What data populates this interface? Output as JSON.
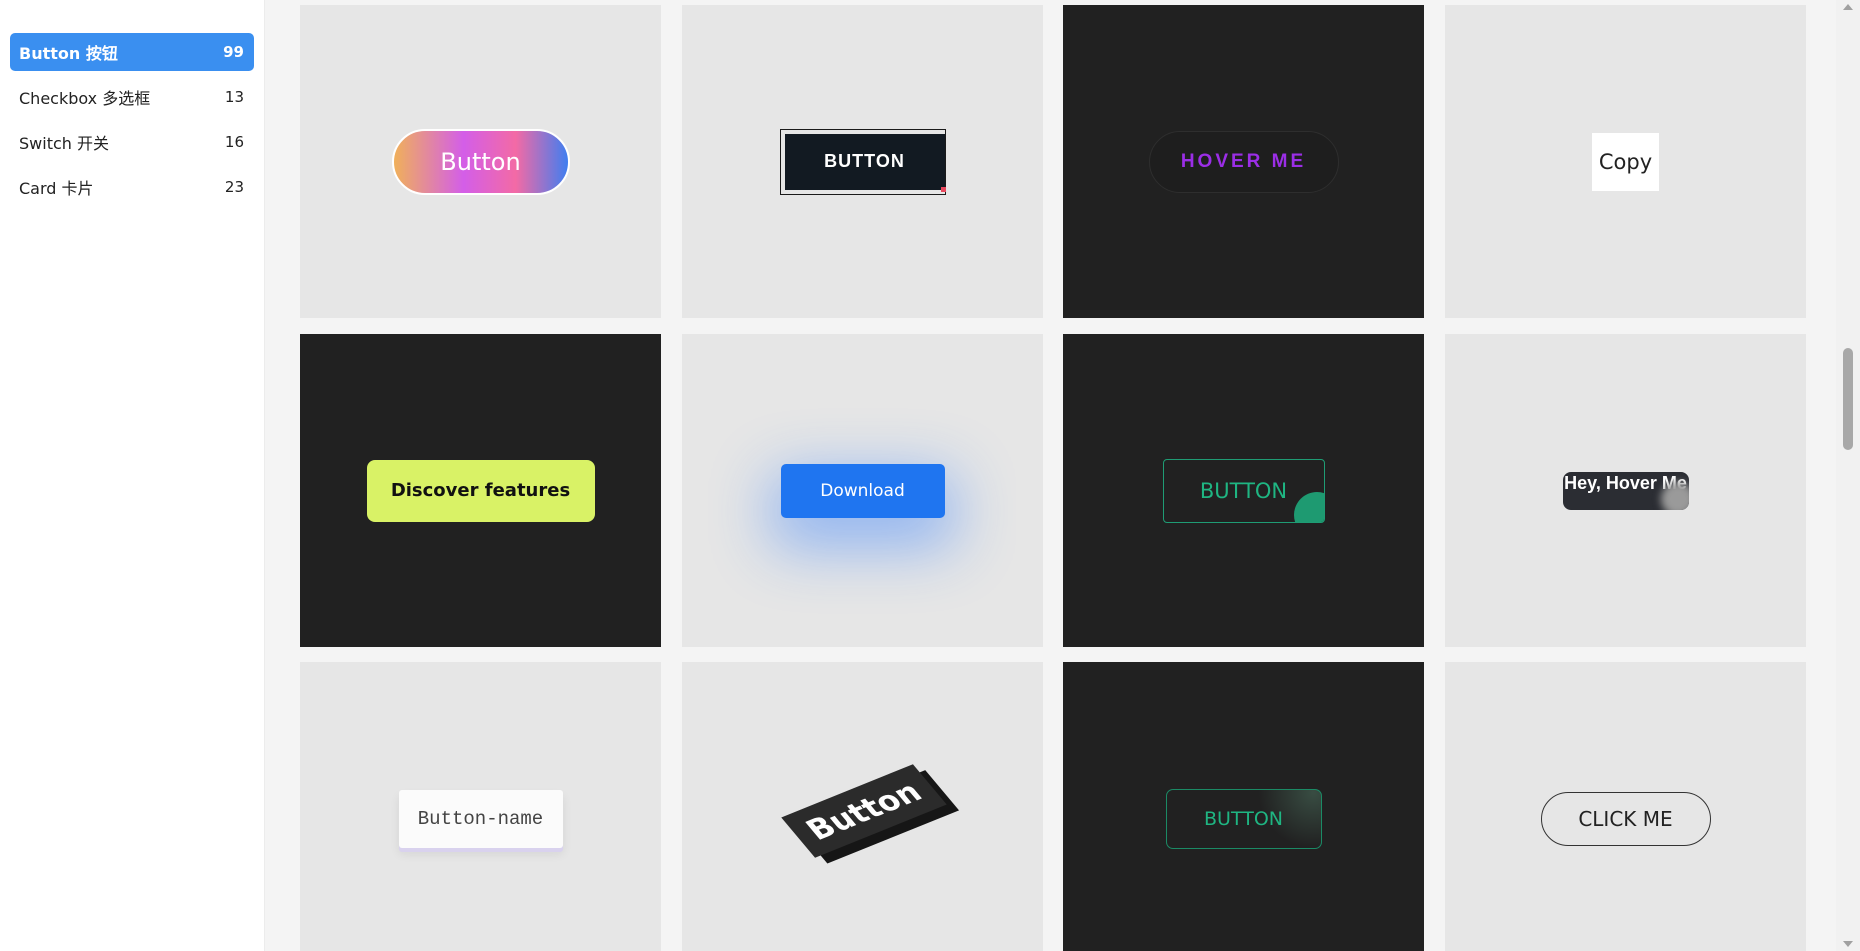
{
  "sidebar": {
    "items": [
      {
        "label": "Button 按钮",
        "count": "99"
      },
      {
        "label": "Checkbox 多选框",
        "count": "13"
      },
      {
        "label": "Switch 开关",
        "count": "16"
      },
      {
        "label": "Card 卡片",
        "count": "23"
      }
    ]
  },
  "grid": {
    "buttons": [
      {
        "label": "Button"
      },
      {
        "label": "BUTTON"
      },
      {
        "label": "HOVER ME"
      },
      {
        "label": "Copy"
      },
      {
        "label": "Discover features"
      },
      {
        "label": "Download"
      },
      {
        "label": "BUTTON"
      },
      {
        "label": "Hey, Hover Me"
      },
      {
        "label": "Button-name"
      },
      {
        "label": "Button"
      },
      {
        "label": "BUTTON"
      },
      {
        "label": "CLICK ME"
      }
    ]
  },
  "colors": {
    "accent": "#3a8ff0",
    "card_light": "#e6e6e6",
    "card_dark": "#212121",
    "lime": "#d9f266",
    "green": "#1fb582",
    "purple": "#9b2ee6"
  }
}
